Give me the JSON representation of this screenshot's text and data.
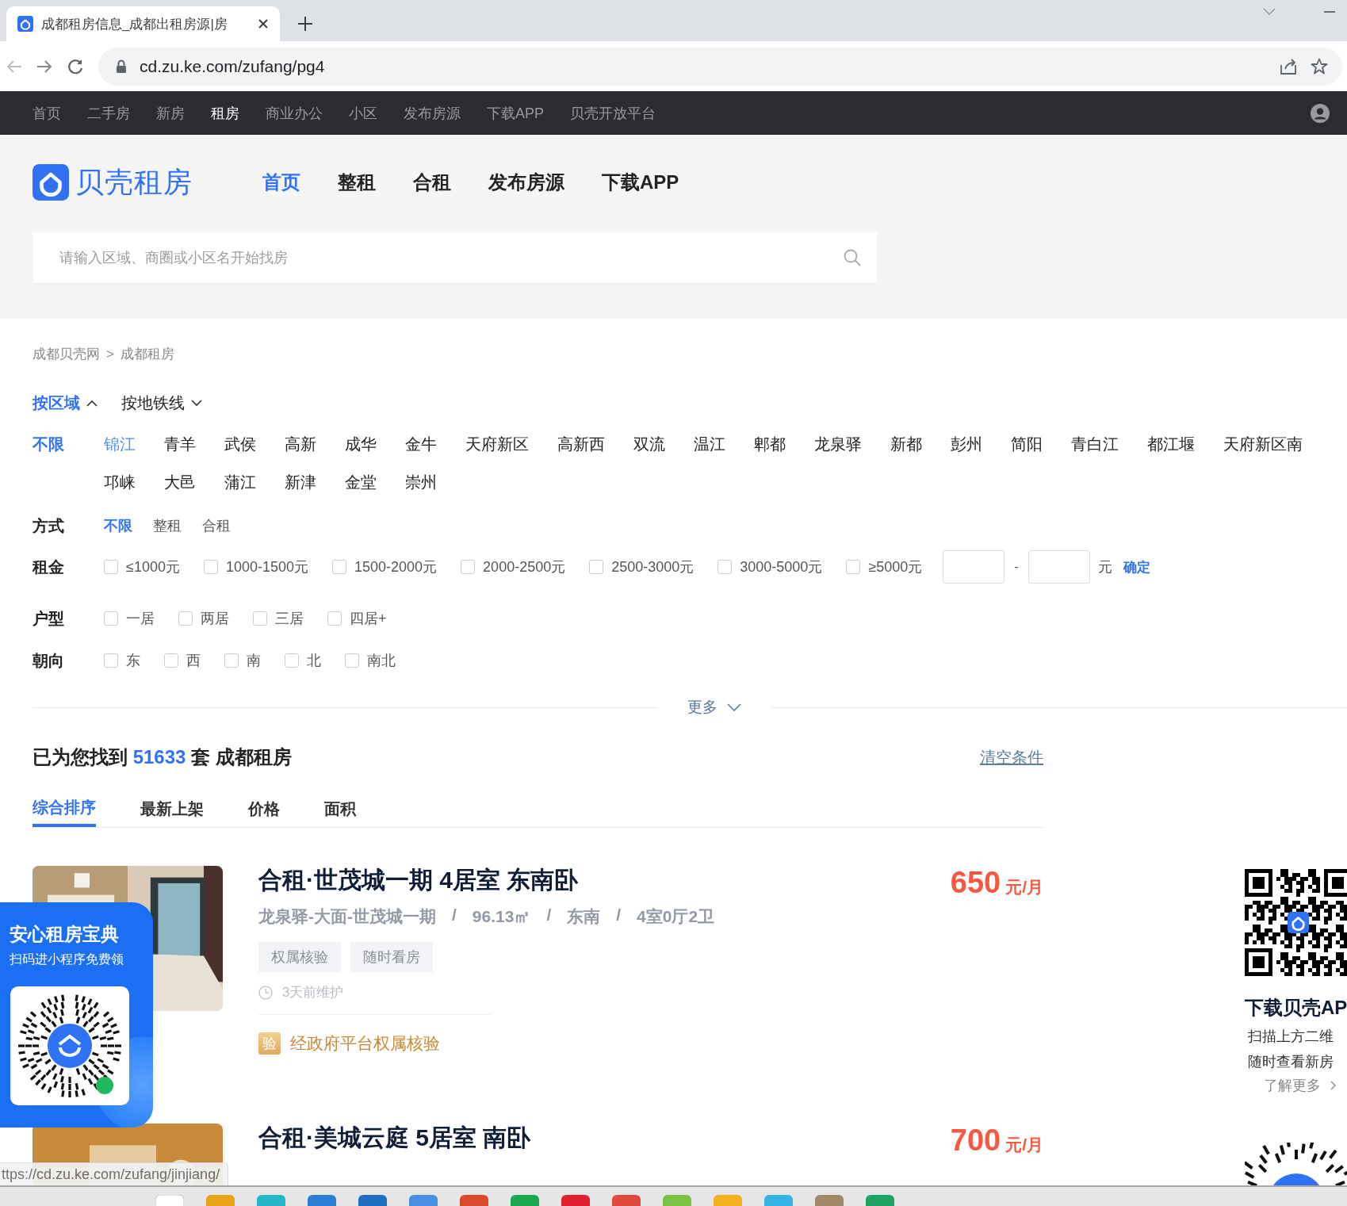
{
  "browser": {
    "tab_title": "成都租房信息_成都出租房源|房",
    "url": "cd.zu.ke.com/zufang/pg4"
  },
  "top_nav": [
    {
      "label": "首页",
      "selected": false
    },
    {
      "label": "二手房",
      "selected": false
    },
    {
      "label": "新房",
      "selected": false
    },
    {
      "label": "租房",
      "selected": true
    },
    {
      "label": "商业办公",
      "selected": false
    },
    {
      "label": "小区",
      "selected": false
    },
    {
      "label": "发布房源",
      "selected": false
    },
    {
      "label": "下载APP",
      "selected": false
    },
    {
      "label": "贝壳开放平台",
      "selected": false
    }
  ],
  "header": {
    "logo_text": "贝壳租房",
    "nav": [
      {
        "label": "首页",
        "selected": true
      },
      {
        "label": "整租",
        "selected": false
      },
      {
        "label": "合租",
        "selected": false
      },
      {
        "label": "发布房源",
        "selected": false
      },
      {
        "label": "下载APP",
        "selected": false
      }
    ],
    "search": {
      "placeholder": "请输入区域、商圈或小区名开始找房"
    }
  },
  "breadcrumb": {
    "items": [
      "成都贝壳网",
      "成都租房"
    ],
    "separator": ">"
  },
  "filters": {
    "modes": [
      {
        "label": "按区域",
        "selected": true,
        "expanded": true
      },
      {
        "label": "按地铁线",
        "selected": false,
        "expanded": false
      }
    ],
    "district_all": {
      "label": "不限",
      "selected": true
    },
    "districts": [
      {
        "label": "锦江",
        "hovered": true
      },
      {
        "label": "青羊",
        "hovered": false
      },
      {
        "label": "武侯",
        "hovered": false
      },
      {
        "label": "高新",
        "hovered": false
      },
      {
        "label": "成华",
        "hovered": false
      },
      {
        "label": "金牛",
        "hovered": false
      },
      {
        "label": "天府新区",
        "hovered": false
      },
      {
        "label": "高新西",
        "hovered": false
      },
      {
        "label": "双流",
        "hovered": false
      },
      {
        "label": "温江",
        "hovered": false
      },
      {
        "label": "郫都",
        "hovered": false
      },
      {
        "label": "龙泉驿",
        "hovered": false
      },
      {
        "label": "新都",
        "hovered": false
      },
      {
        "label": "彭州",
        "hovered": false
      },
      {
        "label": "简阳",
        "hovered": false
      },
      {
        "label": "青白江",
        "hovered": false
      },
      {
        "label": "都江堰",
        "hovered": false
      },
      {
        "label": "天府新区南",
        "hovered": false
      },
      {
        "label": "邛崃",
        "hovered": false
      },
      {
        "label": "大邑",
        "hovered": false
      },
      {
        "label": "蒲江",
        "hovered": false
      },
      {
        "label": "新津",
        "hovered": false
      },
      {
        "label": "金堂",
        "hovered": false
      },
      {
        "label": "崇州",
        "hovered": false
      }
    ],
    "rows": [
      {
        "label": "方式",
        "kind": "options",
        "options": [
          {
            "label": "不限",
            "selected": true
          },
          {
            "label": "整租",
            "selected": false
          },
          {
            "label": "合租",
            "selected": false
          }
        ]
      },
      {
        "label": "租金",
        "kind": "checkboxes",
        "options": [
          {
            "label": "≤1000元",
            "checked": false
          },
          {
            "label": "1000-1500元",
            "checked": false
          },
          {
            "label": "1500-2000元",
            "checked": false
          },
          {
            "label": "2000-2500元",
            "checked": false
          },
          {
            "label": "2500-3000元",
            "checked": false
          },
          {
            "label": "3000-5000元",
            "checked": false
          },
          {
            "label": "≥5000元",
            "checked": false
          }
        ],
        "range": {
          "separator": "-",
          "unit": "元",
          "confirm": "确定"
        }
      },
      {
        "label": "户型",
        "kind": "checkboxes",
        "options": [
          {
            "label": "一居",
            "checked": false
          },
          {
            "label": "两居",
            "checked": false
          },
          {
            "label": "三居",
            "checked": false
          },
          {
            "label": "四居+",
            "checked": false
          }
        ]
      },
      {
        "label": "朝向",
        "kind": "checkboxes",
        "options": [
          {
            "label": "东",
            "checked": false
          },
          {
            "label": "西",
            "checked": false
          },
          {
            "label": "南",
            "checked": false
          },
          {
            "label": "北",
            "checked": false
          },
          {
            "label": "南北",
            "checked": false
          }
        ]
      }
    ],
    "more": "更多"
  },
  "results": {
    "prefix": "已为您找到",
    "count": "51633",
    "suffix": "套 成都租房",
    "clear": "清空条件",
    "sort_tabs": [
      {
        "label": "综合排序",
        "selected": true
      },
      {
        "label": "最新上架",
        "selected": false
      },
      {
        "label": "价格",
        "selected": false
      },
      {
        "label": "面积",
        "selected": false
      }
    ]
  },
  "listings": [
    {
      "kind": "full",
      "title": "合租·世茂城一期 4居室 东南卧",
      "meta": [
        "龙泉驿-大面-世茂城一期",
        "96.13㎡",
        "东南",
        "4室0厅2卫"
      ],
      "meta_separator": "/",
      "tags": [
        "权属核验",
        "随时看房"
      ],
      "maintained": "3天前维护",
      "verified_badge": "验",
      "verified": "经政府平台权属核验",
      "price": "650",
      "price_unit": "元/月"
    },
    {
      "kind": "partial",
      "title": "合租·美城云庭 5居室 南卧",
      "price": "700",
      "price_unit": "元/月"
    }
  ],
  "promo": {
    "title": "安心租房宝典",
    "subtitle": "扫码进小程序免费领"
  },
  "app_download": {
    "title": "下载贝壳AP",
    "lines": [
      "扫描上方二维",
      "随时查看新房"
    ],
    "more": "了解更多"
  },
  "status_url": "ttps://cd.zu.ke.com/zufang/jinjiang/"
}
